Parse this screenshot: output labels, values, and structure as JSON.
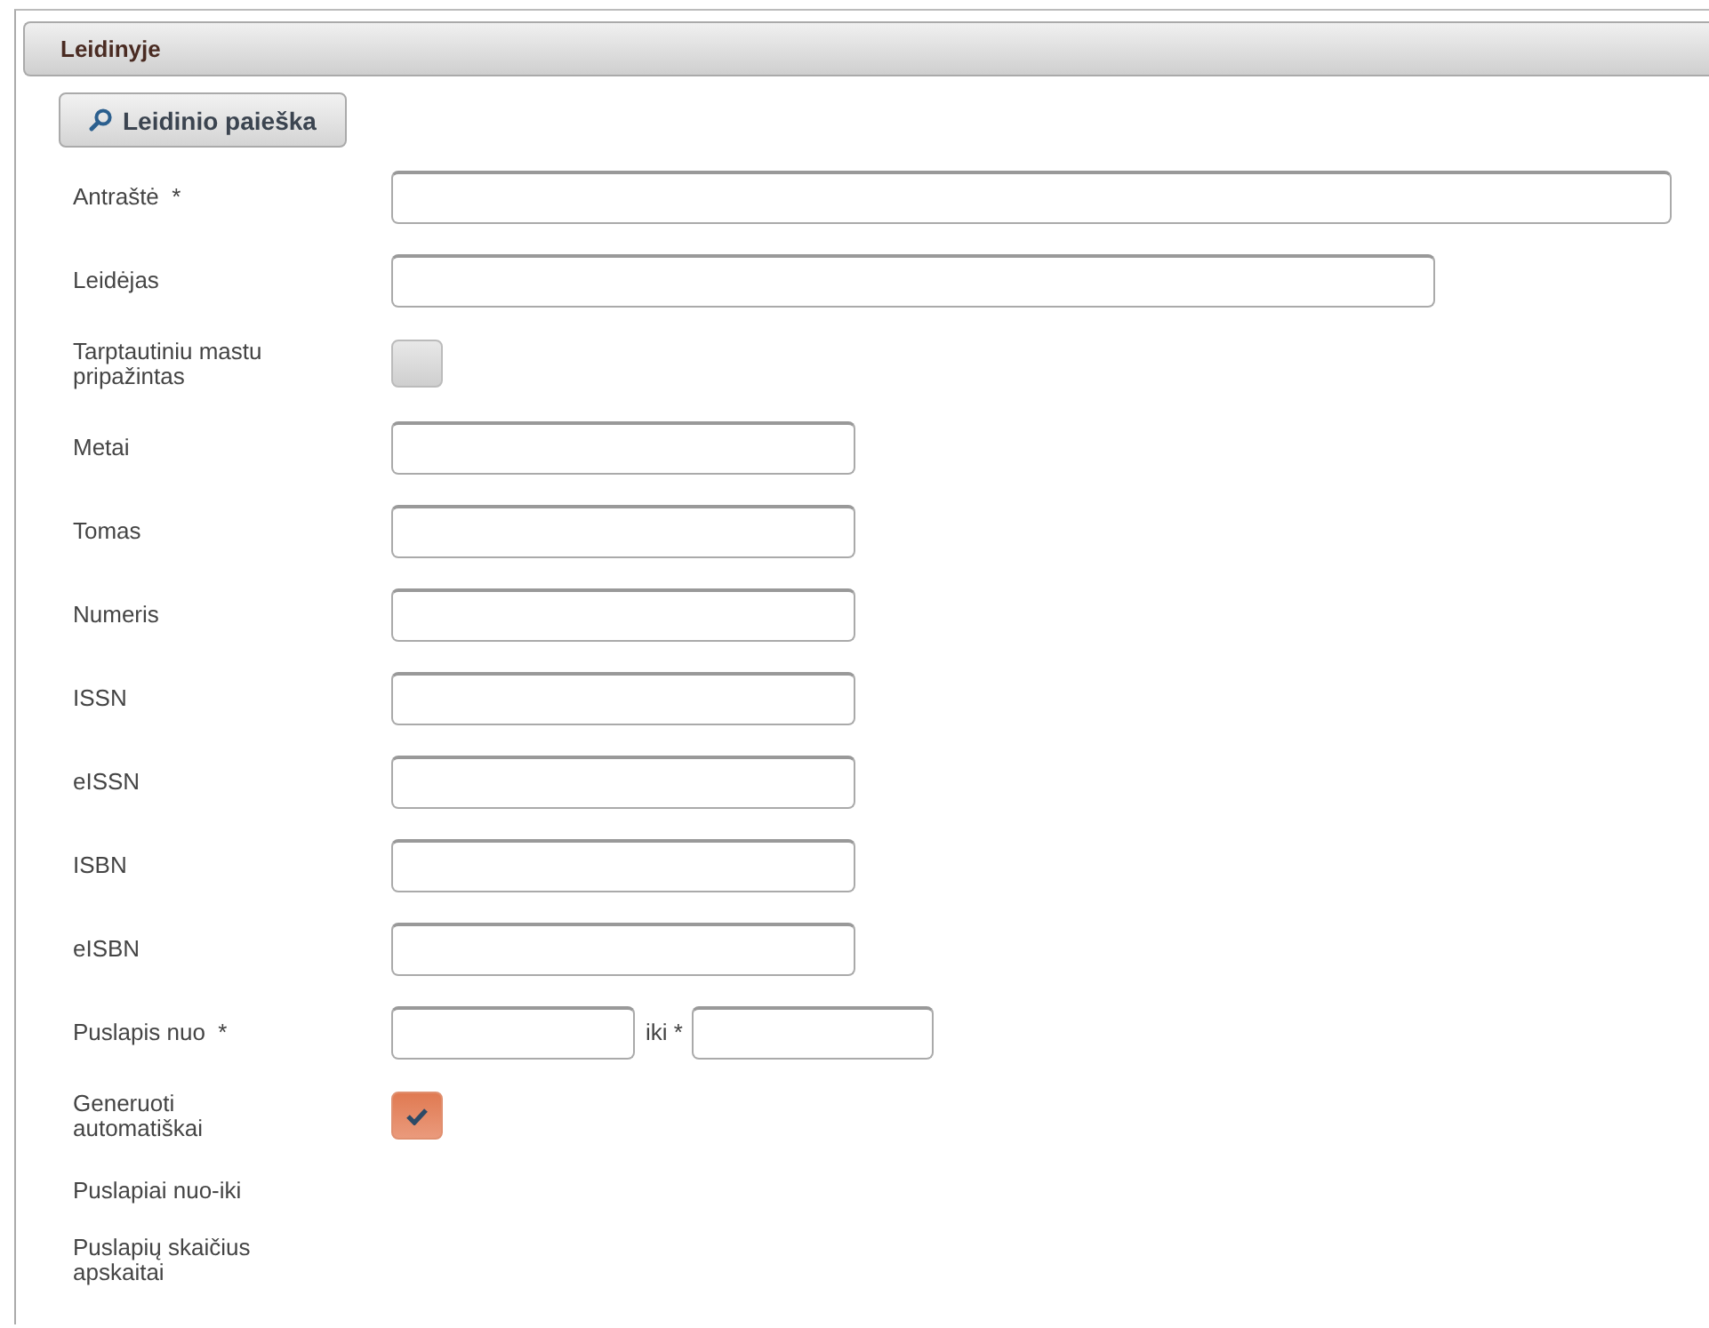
{
  "panel": {
    "title": "Leidinyje"
  },
  "search_button": {
    "label": "Leidinio paieška"
  },
  "fields": [
    {
      "label": "Antraštė  *",
      "kind": "wide"
    },
    {
      "label": "Leidėjas",
      "kind": "medium"
    },
    {
      "label": "Tarptautiniu mastu pripažintas",
      "kind": "checkbox",
      "checked": false
    },
    {
      "label": "Metai",
      "kind": "short"
    },
    {
      "label": "Tomas",
      "kind": "short"
    },
    {
      "label": "Numeris",
      "kind": "short"
    },
    {
      "label": "ISSN",
      "kind": "short"
    },
    {
      "label": "eISSN",
      "kind": "short"
    },
    {
      "label": "ISBN",
      "kind": "short"
    },
    {
      "label": "eISBN",
      "kind": "short"
    },
    {
      "label": "Puslapis nuo  *",
      "kind": "range",
      "to_label": "iki *"
    },
    {
      "label": "Generuoti automatiškai",
      "kind": "checkbox",
      "checked": true
    },
    {
      "label": "Puslapiai nuo-iki",
      "kind": "none"
    },
    {
      "label": "Puslapių skaičius apskaitai",
      "kind": "none"
    }
  ]
}
